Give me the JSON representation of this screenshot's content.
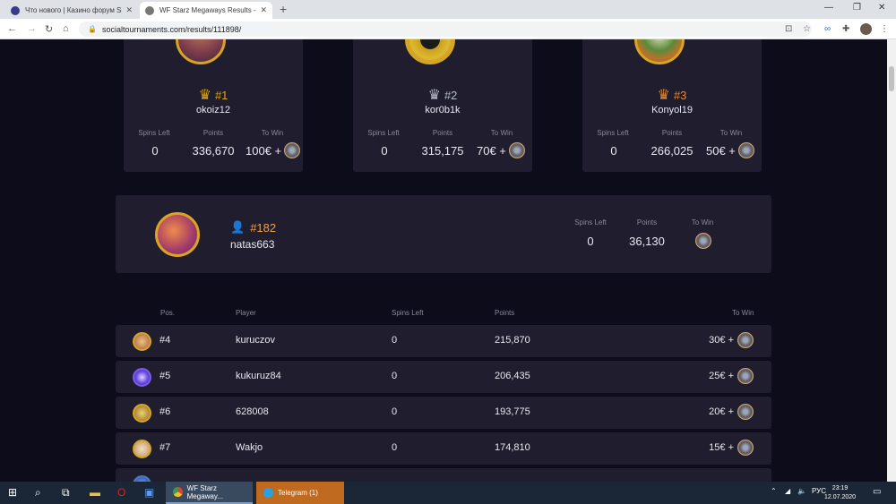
{
  "browser": {
    "tabs": [
      {
        "title": "Что нового | Казино форум Sm..."
      },
      {
        "title": "WF Starz Megaways Results - So..."
      }
    ],
    "new_tab": "+",
    "url": "socialtournaments.com/results/111898/"
  },
  "podium": [
    {
      "rank": "#1",
      "name": "okoiz12",
      "spins_label": "Spins Left",
      "points_label": "Points",
      "towin_label": "To Win",
      "spins": "0",
      "points": "336,670",
      "towin": "100€ +",
      "rank_color": "#d9a520"
    },
    {
      "rank": "#2",
      "name": "kor0b1k",
      "spins_label": "Spins Left",
      "points_label": "Points",
      "towin_label": "To Win",
      "spins": "0",
      "points": "315,175",
      "towin": "70€ +",
      "rank_color": "#b8bcc8"
    },
    {
      "rank": "#3",
      "name": "Konyol19",
      "spins_label": "Spins Left",
      "points_label": "Points",
      "towin_label": "To Win",
      "spins": "0",
      "points": "266,025",
      "towin": "50€ +",
      "rank_color": "#e08a3c"
    }
  ],
  "me": {
    "rank": "#182",
    "name": "natas663",
    "spins_label": "Spins Left",
    "points_label": "Points",
    "towin_label": "To Win",
    "spins": "0",
    "points": "36,130"
  },
  "table": {
    "headers": {
      "pos": "Pos.",
      "player": "Player",
      "spins": "Spins Left",
      "points": "Points",
      "towin": "To Win"
    },
    "rows": [
      {
        "pos": "#4",
        "player": "kuruczov",
        "spins": "0",
        "points": "215,870",
        "towin": "30€ +"
      },
      {
        "pos": "#5",
        "player": "kukuruz84",
        "spins": "0",
        "points": "206,435",
        "towin": "25€ +"
      },
      {
        "pos": "#6",
        "player": "628008",
        "spins": "0",
        "points": "193,775",
        "towin": "20€ +"
      },
      {
        "pos": "#7",
        "player": "Wakjo",
        "spins": "0",
        "points": "174,810",
        "towin": "15€ +"
      }
    ]
  },
  "taskbar": {
    "apps": [
      {
        "label": "WF Starz Megaway..."
      },
      {
        "label": "Telegram (1)"
      }
    ],
    "lang": "РУС",
    "time": "23:19",
    "date": "12.07.2020"
  }
}
